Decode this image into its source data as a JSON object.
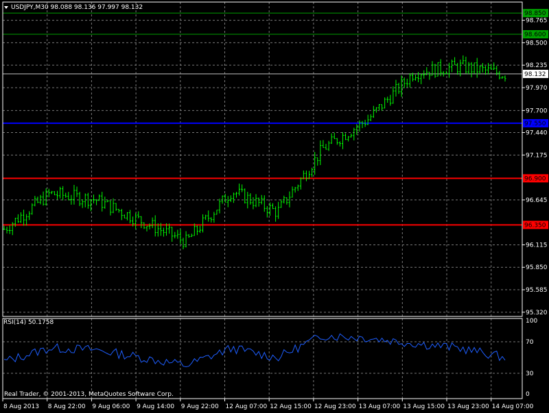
{
  "colors": {
    "background": "#000000",
    "grid": "#7a7a7a",
    "frame": "#ffffff",
    "candle": "#00ff00",
    "rsi_line": "#1e5eff",
    "current_price_line": "#c0c0c0",
    "level_green": "#00a000",
    "level_blue": "#0000ff",
    "level_red": "#ff0000"
  },
  "header": {
    "menu_icon": "triangle-down-icon",
    "label": "USDJPY,M30  98.088 98.136 97.997 98.132"
  },
  "price_axis": {
    "ticks": [
      {
        "value": 98.765,
        "label": "98.765"
      },
      {
        "value": 98.5,
        "label": "98.500"
      },
      {
        "value": 98.235,
        "label": "98.235"
      },
      {
        "value": 97.97,
        "label": "97.970"
      },
      {
        "value": 97.7,
        "label": "97.700"
      },
      {
        "value": 97.44,
        "label": "97.440"
      },
      {
        "value": 97.175,
        "label": "97.175"
      },
      {
        "value": 96.645,
        "label": "96.645"
      },
      {
        "value": 96.115,
        "label": "96.115"
      },
      {
        "value": 95.85,
        "label": "95.850"
      },
      {
        "value": 95.585,
        "label": "95.585"
      },
      {
        "value": 95.32,
        "label": "95.320"
      }
    ]
  },
  "levels": [
    {
      "value": 98.85,
      "label": "98.850",
      "color": "#00a000"
    },
    {
      "value": 98.6,
      "label": "98.600",
      "color": "#00a000"
    },
    {
      "value": 97.55,
      "label": "97.550",
      "color": "#0000ff"
    },
    {
      "value": 96.9,
      "label": "96.900",
      "color": "#ff0000"
    },
    {
      "value": 96.35,
      "label": "96.350",
      "color": "#ff0000"
    }
  ],
  "current_price": {
    "value": 98.132,
    "label": "98.132"
  },
  "rsi": {
    "label": "RSI(14) 50.1758",
    "ticks": [
      {
        "value": 100,
        "label": "100"
      },
      {
        "value": 70,
        "label": "70"
      },
      {
        "value": 30,
        "label": "30"
      },
      {
        "value": 0,
        "label": "0"
      }
    ]
  },
  "time_axis": [
    "8 Aug 2013",
    "8 Aug 22:00",
    "9 Aug 06:00",
    "9 Aug 14:00",
    "9 Aug 22:00",
    "12 Aug 07:00",
    "12 Aug 15:00",
    "12 Aug 23:00",
    "13 Aug 07:00",
    "13 Aug 15:00",
    "13 Aug 23:00",
    "14 Aug 07:00"
  ],
  "copyright": "Real Trader, © 2001-2013, MetaQuotes Software Corp.",
  "chart_data": {
    "type": "line",
    "title": "USDJPY,M30",
    "ylim": [
      95.32,
      99.0
    ],
    "x": [
      "8 Aug 2013",
      "8 Aug 22:00",
      "9 Aug 06:00",
      "9 Aug 14:00",
      "9 Aug 22:00",
      "12 Aug 07:00",
      "12 Aug 15:00",
      "12 Aug 23:00",
      "13 Aug 07:00",
      "13 Aug 15:00",
      "13 Aug 23:00",
      "14 Aug 07:00"
    ],
    "series": [
      {
        "values": [
          96.3,
          96.72,
          96.65,
          96.4,
          96.15,
          96.75,
          96.5,
          97.25,
          97.6,
          98.15,
          98.22,
          98.13
        ]
      },
      {
        "name": "RSI(14)",
        "values": [
          45,
          62,
          60,
          50,
          40,
          62,
          50,
          78,
          75,
          68,
          62,
          50
        ]
      }
    ]
  }
}
